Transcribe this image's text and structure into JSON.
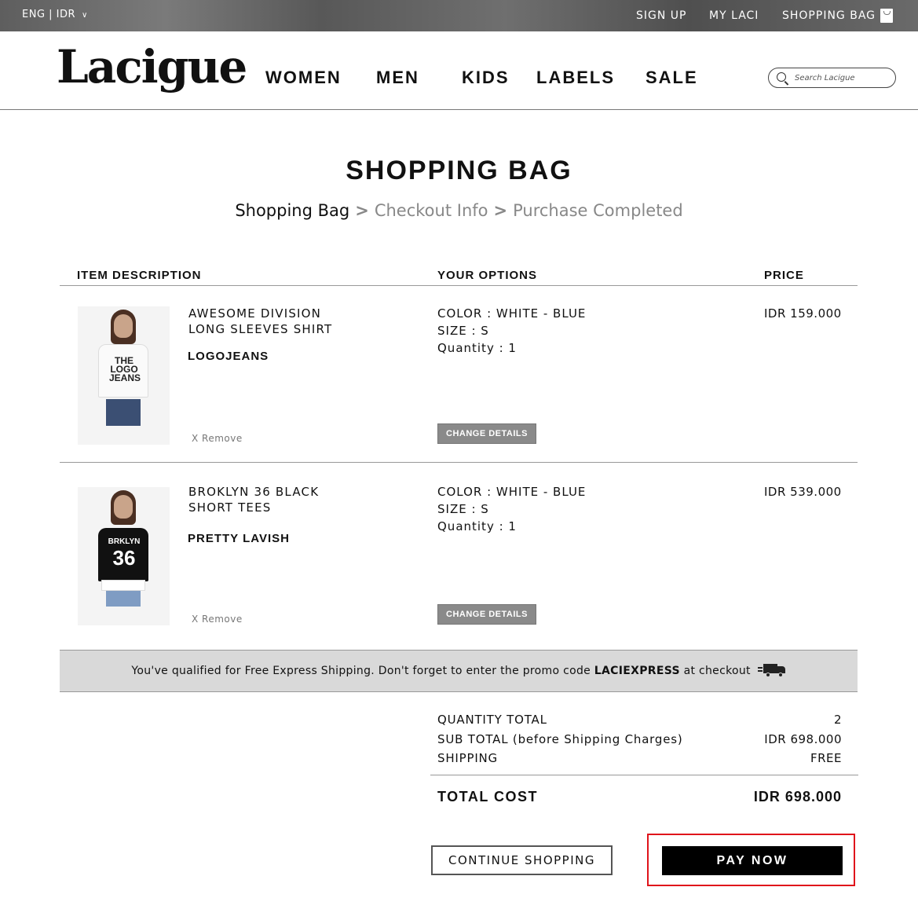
{
  "topbar": {
    "lang_currency": "ENG | IDR",
    "sign_up": "SIGN UP",
    "my_laci": "MY LACI",
    "shopping_bag": "SHOPPING BAG"
  },
  "header": {
    "logo": "Lacigue",
    "nav": [
      "WOMEN",
      "MEN",
      "KIDS",
      "LABELS",
      "SALE"
    ],
    "search_placeholder": "Search Lacigue"
  },
  "page": {
    "title": "SHOPPING BAG",
    "breadcrumb": [
      "Shopping Bag",
      "Checkout Info",
      "Purchase Completed"
    ],
    "breadcrumb_sep": ">"
  },
  "table": {
    "headers": [
      "ITEM DESCRIPTION",
      "YOUR OPTIONS",
      "PRICE"
    ]
  },
  "items": [
    {
      "name_line1": "AWESOME DIVISION",
      "name_line2": "LONG SLEEVES SHIRT",
      "brand": "LOGOJEANS",
      "remove": "X Remove",
      "color": "COLOR : WHITE - BLUE",
      "size": "SIZE : S",
      "quantity": "Quantity : 1",
      "change_details": "CHANGE DETAILS",
      "price": "IDR 159.000",
      "print_text": [
        "THE",
        "LOGO",
        "JEANS"
      ]
    },
    {
      "name_line1": "BROKLYN 36 BLACK",
      "name_line2": "SHORT TEES",
      "brand": "PRETTY LAVISH",
      "remove": "X Remove",
      "color": "COLOR : WHITE - BLUE",
      "size": "SIZE : S",
      "quantity": "Quantity : 1",
      "change_details": "CHANGE DETAILS",
      "price": "IDR 539.000",
      "print_text": [
        "BRKLYN",
        "36"
      ]
    }
  ],
  "promo": {
    "text_before": "You've qualified for Free Express Shipping. Don't forget to enter the promo code ",
    "code": "LACIEXPRESS",
    "text_after": " at checkout"
  },
  "summary": {
    "quantity_total_label": "QUANTITY TOTAL",
    "quantity_total_value": "2",
    "subtotal_label": "SUB TOTAL (before Shipping Charges)",
    "subtotal_value": "IDR 698.000",
    "shipping_label": "SHIPPING",
    "shipping_value": "FREE",
    "total_label": "TOTAL COST",
    "total_value": "IDR 698.000"
  },
  "actions": {
    "continue_shopping": "CONTINUE SHOPPING",
    "pay_now": "PAY NOW"
  },
  "colors": {
    "highlight_border": "#e0141b",
    "button_dark": "#000000",
    "button_gray": "#8a8a8a",
    "promo_bg": "#d9d9d9"
  }
}
